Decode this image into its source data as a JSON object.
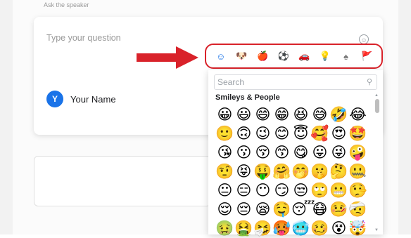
{
  "form": {
    "cut_label": "Ask the speaker",
    "question_placeholder": "Type your question",
    "author_initial": "Y",
    "author_name": "Your Name"
  },
  "emoji_toggle": {
    "icon": "smiley-outline-icon",
    "glyph": "☺"
  },
  "category_bar": {
    "highlight_color": "#d9222a",
    "categories": [
      {
        "name": "smileys-people",
        "glyph": "☺",
        "active": true
      },
      {
        "name": "animals-nature",
        "glyph": "🐶",
        "active": false
      },
      {
        "name": "food-drink",
        "glyph": "🍎",
        "active": false
      },
      {
        "name": "activity",
        "glyph": "⚽",
        "active": false
      },
      {
        "name": "travel-places",
        "glyph": "🚗",
        "active": false
      },
      {
        "name": "objects",
        "glyph": "💡",
        "active": false
      },
      {
        "name": "symbols",
        "glyph": "♠",
        "active": false
      },
      {
        "name": "flags",
        "glyph": "🚩",
        "active": false
      }
    ]
  },
  "emoji_picker": {
    "search_placeholder": "Search",
    "section_title": "Smileys & People",
    "emojis": [
      "😀",
      "😃",
      "😄",
      "😁",
      "😆",
      "😅",
      "🤣",
      "😂",
      "🙂",
      "🙃",
      "😉",
      "😊",
      "😇",
      "🥰",
      "😍",
      "🤩",
      "😘",
      "😗",
      "😚",
      "😙",
      "😋",
      "😛",
      "😜",
      "🤪",
      "🤨",
      "😝",
      "🤑",
      "🤗",
      "🤭",
      "🤫",
      "🤔",
      "🤐",
      "😐",
      "😑",
      "😶",
      "😏",
      "😒",
      "🙄",
      "😬",
      "🤥",
      "😌",
      "😔",
      "😪",
      "🤤",
      "😴",
      "😷",
      "🤒",
      "🤕",
      "🤢",
      "🤮",
      "🤧",
      "🥵",
      "🥶",
      "🥴",
      "😵",
      "🤯"
    ]
  },
  "colors": {
    "accent": "#1a73e8",
    "arrow": "#d9222a",
    "emoji_yellow": "#f6c343"
  }
}
